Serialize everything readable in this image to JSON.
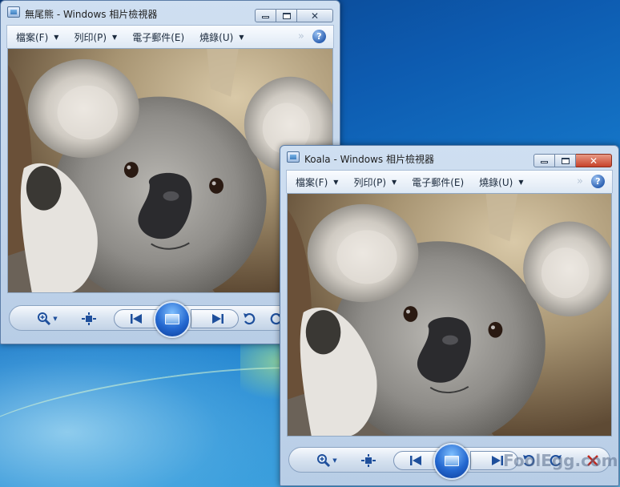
{
  "windows": [
    {
      "title": "無尾熊 - Windows 相片檢視器",
      "menu": {
        "file": "檔案(F)",
        "print": "列印(P)",
        "email": "電子郵件(E)",
        "burn": "燒錄(U)"
      },
      "more": "»",
      "help": "?"
    },
    {
      "title": "Koala - Windows 相片檢視器",
      "menu": {
        "file": "檔案(F)",
        "print": "列印(P)",
        "email": "電子郵件(E)",
        "burn": "燒錄(U)"
      },
      "more": "»",
      "help": "?"
    }
  ],
  "icons": [
    "photo-viewer-app-icon",
    "minimize-icon",
    "maximize-icon",
    "close-icon",
    "help-icon",
    "zoom-icon",
    "fit-to-window-icon",
    "previous-icon",
    "slideshow-icon",
    "next-icon",
    "rotate-left-icon",
    "rotate-right-icon",
    "delete-icon"
  ],
  "watermark": "FoolEgg.com"
}
